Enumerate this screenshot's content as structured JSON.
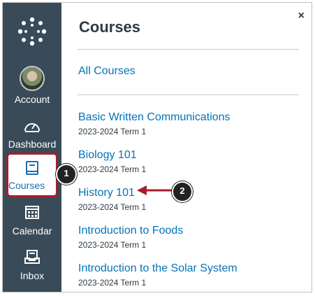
{
  "sidebar": {
    "items": [
      {
        "label": "Account",
        "icon": "avatar"
      },
      {
        "label": "Dashboard",
        "icon": "dashboard-icon"
      },
      {
        "label": "Courses",
        "icon": "courses-icon"
      },
      {
        "label": "Calendar",
        "icon": "calendar-icon"
      },
      {
        "label": "Inbox",
        "icon": "inbox-icon"
      }
    ]
  },
  "tray": {
    "title": "Courses",
    "close_icon": "×",
    "all_courses_label": "All Courses",
    "courses": [
      {
        "name": "Basic Written Communications",
        "term": "2023-2024 Term 1"
      },
      {
        "name": "Biology 101",
        "term": "2023-2024 Term 1"
      },
      {
        "name": "History 101",
        "term": "2023-2024 Term 1"
      },
      {
        "name": "Introduction to Foods",
        "term": "2023-2024 Term 1"
      },
      {
        "name": "Introduction to the Solar System",
        "term": "2023-2024 Term 1"
      }
    ]
  },
  "callouts": [
    "1",
    "2"
  ],
  "colors": {
    "sidebar": "#394b58",
    "link": "#0374b5",
    "highlight": "#a81d2b",
    "callout_arrow": "#a81d2b"
  }
}
